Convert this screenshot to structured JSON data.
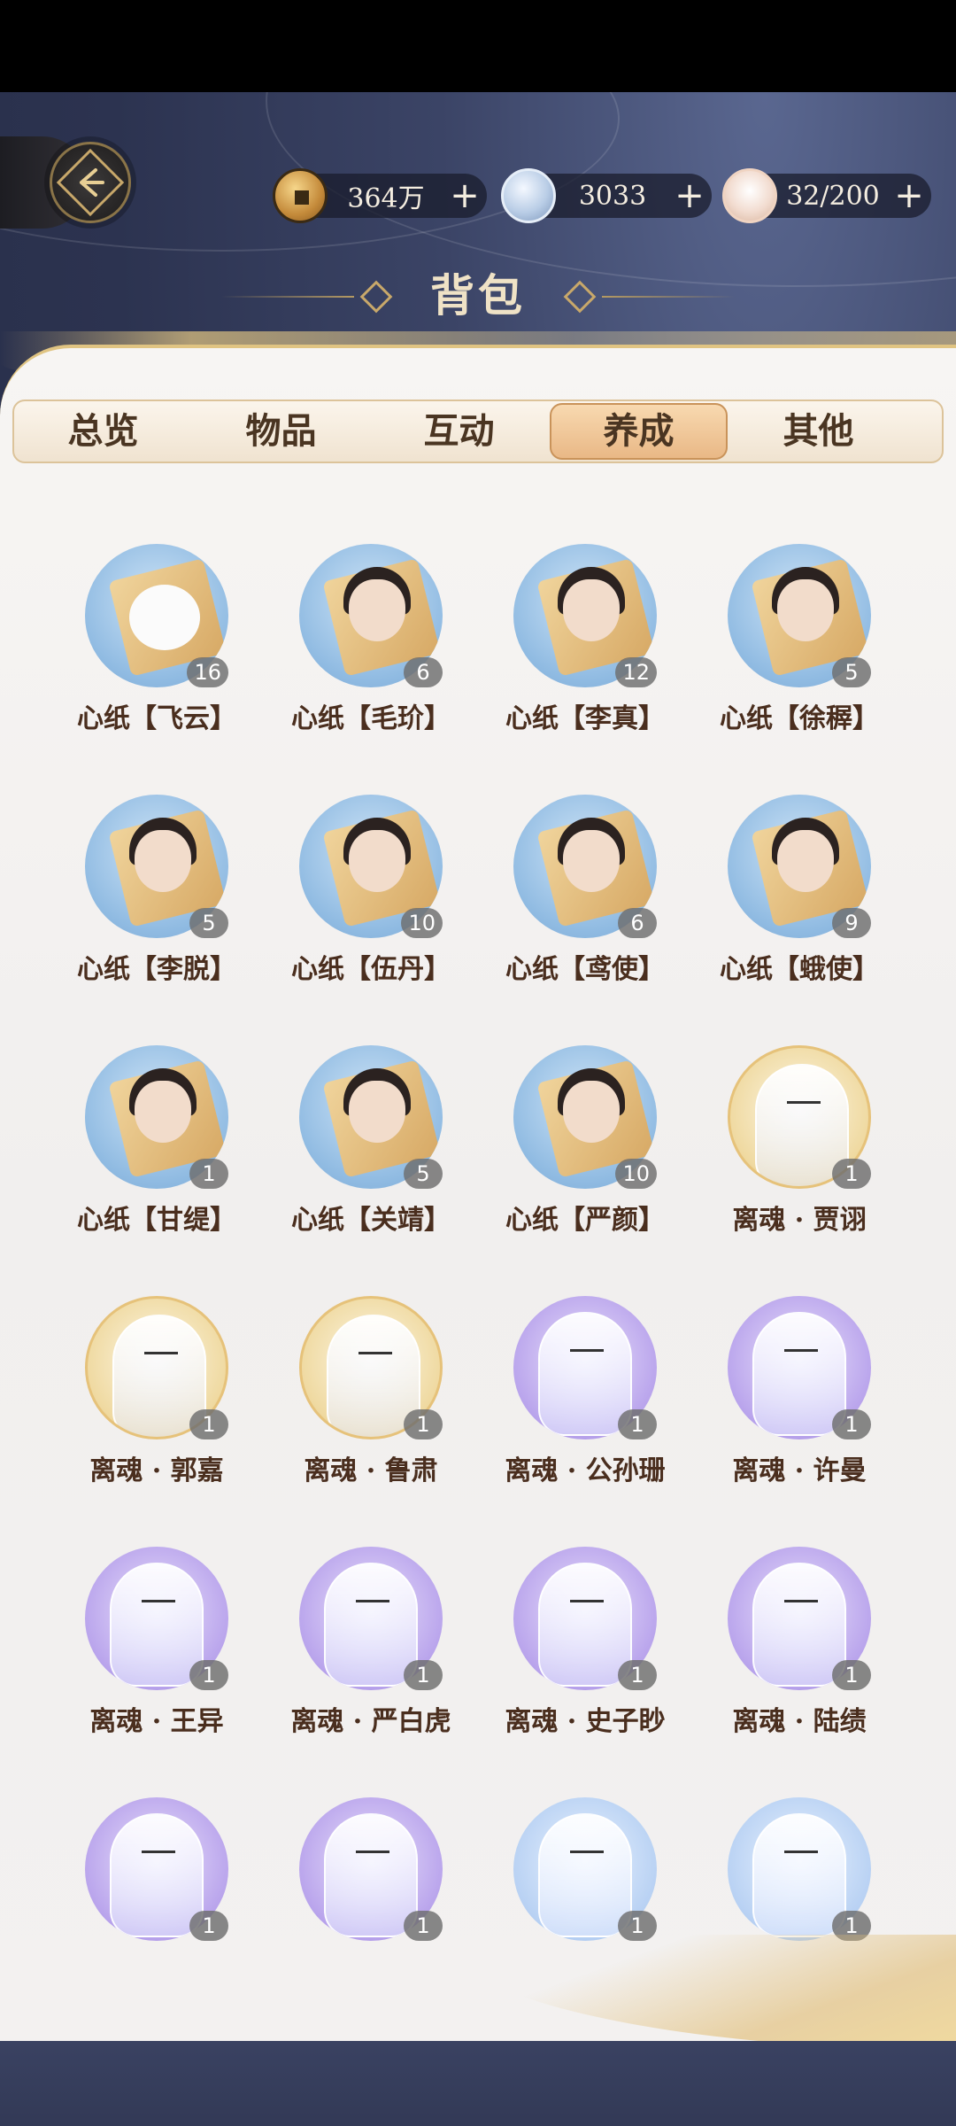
{
  "currencies": [
    {
      "icon": "copper-coin-icon",
      "value": "364万"
    },
    {
      "icon": "jade-orb-icon",
      "value": "3033"
    },
    {
      "icon": "food-bowl-icon",
      "value": "32/200"
    }
  ],
  "plus_symbol": "+",
  "title": "背包",
  "tabs": [
    "总览",
    "物品",
    "互动",
    "养成",
    "其他"
  ],
  "active_tab": "养成",
  "items": [
    {
      "name": "心纸【飞云】",
      "count": "16",
      "style": "blue",
      "kind": "dog"
    },
    {
      "name": "心纸【毛玠】",
      "count": "6",
      "style": "blue",
      "kind": "portrait"
    },
    {
      "name": "心纸【李真】",
      "count": "12",
      "style": "blue",
      "kind": "portrait"
    },
    {
      "name": "心纸【徐稺】",
      "count": "5",
      "style": "blue",
      "kind": "portrait"
    },
    {
      "name": "心纸【李脱】",
      "count": "5",
      "style": "blue",
      "kind": "portrait"
    },
    {
      "name": "心纸【伍丹】",
      "count": "10",
      "style": "blue",
      "kind": "portrait"
    },
    {
      "name": "心纸【鸢使】",
      "count": "6",
      "style": "blue",
      "kind": "portrait"
    },
    {
      "name": "心纸【蛾使】",
      "count": "9",
      "style": "blue",
      "kind": "portrait"
    },
    {
      "name": "心纸【甘缇】",
      "count": "1",
      "style": "blue",
      "kind": "portrait"
    },
    {
      "name": "心纸【关靖】",
      "count": "5",
      "style": "blue",
      "kind": "portrait"
    },
    {
      "name": "心纸【严颜】",
      "count": "10",
      "style": "blue",
      "kind": "portrait"
    },
    {
      "name": "离魂 · 贾诩",
      "count": "1",
      "style": "gold",
      "kind": "spirit"
    },
    {
      "name": "离魂 · 郭嘉",
      "count": "1",
      "style": "gold",
      "kind": "spirit"
    },
    {
      "name": "离魂 · 鲁肃",
      "count": "1",
      "style": "gold",
      "kind": "spirit"
    },
    {
      "name": "离魂 · 公孙珊",
      "count": "1",
      "style": "violet",
      "kind": "spirit"
    },
    {
      "name": "离魂 · 许曼",
      "count": "1",
      "style": "violet",
      "kind": "spirit"
    },
    {
      "name": "离魂 · 王异",
      "count": "1",
      "style": "violet",
      "kind": "spirit"
    },
    {
      "name": "离魂 · 严白虎",
      "count": "1",
      "style": "violet",
      "kind": "spirit"
    },
    {
      "name": "离魂 · 史子眇",
      "count": "1",
      "style": "violet",
      "kind": "spirit"
    },
    {
      "name": "离魂 · 陆绩",
      "count": "1",
      "style": "violet",
      "kind": "spirit"
    },
    {
      "name": "",
      "count": "1",
      "style": "violet",
      "kind": "spirit"
    },
    {
      "name": "",
      "count": "1",
      "style": "violet",
      "kind": "spirit"
    },
    {
      "name": "",
      "count": "1",
      "style": "pale",
      "kind": "spirit"
    },
    {
      "name": "",
      "count": "1",
      "style": "pale",
      "kind": "spirit"
    }
  ]
}
